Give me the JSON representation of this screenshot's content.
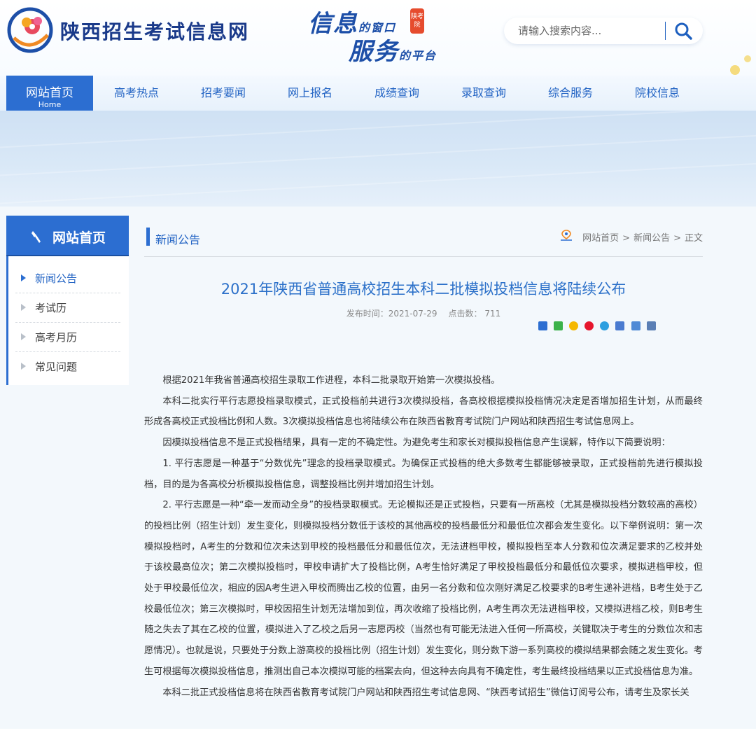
{
  "site": {
    "title": "陕西招生考试信息网"
  },
  "slogan": {
    "line1_big": "信息",
    "line1_small": "的窗口",
    "line2_big": "服务",
    "line2_small": "的平台",
    "seal": "陕考院"
  },
  "search": {
    "placeholder": "请输入搜索内容..."
  },
  "nav": {
    "home_cn": "网站首页",
    "home_en": "Home",
    "items": [
      "高考热点",
      "招考要闻",
      "网上报名",
      "成绩查询",
      "录取查询",
      "综合服务",
      "院校信息"
    ]
  },
  "sidebar": {
    "title": "网站首页",
    "items": [
      "新闻公告",
      "考试历",
      "高考月历",
      "常见问题"
    ]
  },
  "section": {
    "title": "新闻公告"
  },
  "breadcrumb": {
    "home": "网站首页",
    "sep": ">",
    "section": "新闻公告",
    "current": "正文"
  },
  "article": {
    "title": "2021年陕西省普通高校招生本科二批模拟投档信息将陆续公布",
    "publish_label": "发布时间：",
    "publish_date": "2021-07-29",
    "views_label": "点击数：",
    "views": "711",
    "paragraphs": [
      "根据2021年我省普通高校招生录取工作进程，本科二批录取开始第一次模拟投档。",
      "本科二批实行平行志愿投档录取模式，正式投档前共进行3次模拟投档，各高校根据模拟投档情况决定是否增加招生计划，从而最终形成各高校正式投档比例和人数。3次模拟投档信息也将陆续公布在陕西省教育考试院门户网站和陕西招生考试信息网上。",
      "因模拟投档信息不是正式投档结果，具有一定的不确定性。为避免考生和家长对模拟投档信息产生误解，特作以下简要说明：",
      "1. 平行志愿是一种基于“分数优先”理念的投档录取模式。为确保正式投档的绝大多数考生都能够被录取，正式投档前先进行模拟投档，目的是为各高校分析模拟投档信息，调整投档比例并增加招生计划。",
      "2. 平行志愿是一种“牵一发而动全身”的投档录取模式。无论模拟还是正式投档，只要有一所高校（尤其是模拟投档分数较高的高校）的投档比例（招生计划）发生变化，则模拟投档分数低于该校的其他高校的投档最低分和最低位次都会发生变化。以下举例说明：第一次模拟投档时，A考生的分数和位次未达到甲校的投档最低分和最低位次，无法进档甲校，模拟投档至本人分数和位次满足要求的乙校并处于该校最高位次；第二次模拟投档时，甲校申请扩大了投档比例，A考生恰好满足了甲校投档最低分和最低位次要求，模拟进档甲校，但处于甲校最低位次，相应的因A考生进入甲校而腾出乙校的位置，由另一名分数和位次刚好满足乙校要求的B考生递补进档，B考生处于乙校最低位次；第三次模拟时，甲校因招生计划无法增加到位，再次收缩了投档比例，A考生再次无法进档甲校，又模拟进档乙校，则B考生随之失去了其在乙校的位置，模拟进入了乙校之后另一志愿丙校（当然也有可能无法进入任何一所高校，关键取决于考生的分数位次和志愿情况）。也就是说，只要处于分数上游高校的投档比例（招生计划）发生变化，则分数下游一系列高校的模拟结果都会随之发生变化。考生可根据每次模拟投档信息，推测出自己本次模拟可能的档案去向，但这种去向具有不确定性，考生最终投档结果以正式投档信息为准。",
      "本科二批正式投档信息将在陕西省教育考试院门户网站和陕西招生考试信息网、“陕西考试招生”微信订阅号公布，请考生及家长关"
    ]
  },
  "colors": {
    "primary": "#2c6ed1",
    "link": "#2364c4",
    "title": "#2b70c9"
  }
}
